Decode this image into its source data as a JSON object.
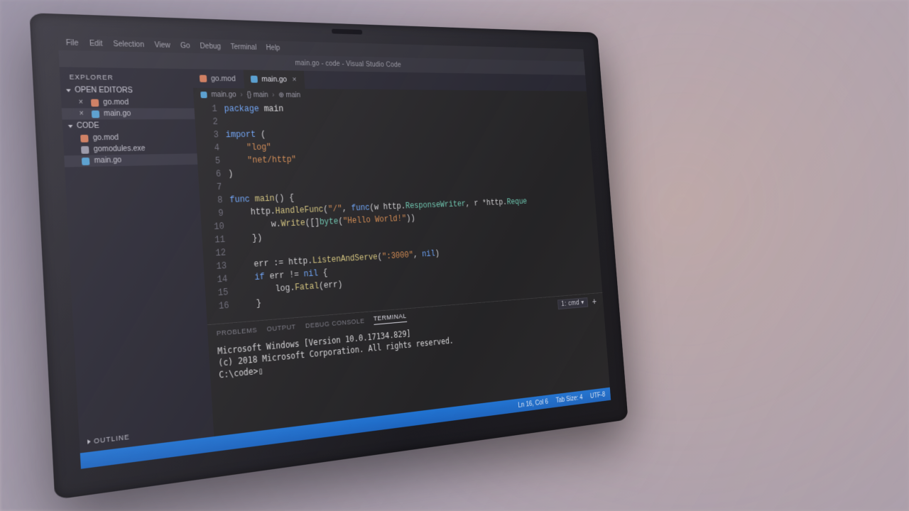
{
  "title": "main.go - code - Visual Studio Code",
  "menu": [
    "File",
    "Edit",
    "Selection",
    "View",
    "Go",
    "Debug",
    "Terminal",
    "Help"
  ],
  "sidebar": {
    "title": "EXPLORER",
    "sections": [
      {
        "label": "OPEN EDITORS",
        "items": [
          {
            "icon": "mod",
            "name": "go.mod",
            "closable": true
          },
          {
            "icon": "go",
            "name": "main.go",
            "closable": true,
            "active": true
          }
        ]
      },
      {
        "label": "CODE",
        "items": [
          {
            "icon": "mod",
            "name": "go.mod"
          },
          {
            "icon": "exe",
            "name": "gomodules.exe"
          },
          {
            "icon": "go",
            "name": "main.go",
            "active": true
          }
        ]
      }
    ],
    "outline": "OUTLINE"
  },
  "tabs": [
    {
      "icon": "mod",
      "label": "go.mod"
    },
    {
      "icon": "go",
      "label": "main.go",
      "active": true,
      "closable": true
    }
  ],
  "breadcrumb": [
    "main.go",
    "{} main",
    "⊕ main"
  ],
  "code": {
    "lines": [
      {
        "n": 1,
        "html": "<span class='kw'>package</span> <span class='pkg'>main</span>"
      },
      {
        "n": 2,
        "html": ""
      },
      {
        "n": 3,
        "html": "<span class='kw'>import</span> ("
      },
      {
        "n": 4,
        "html": "    <span class='str'>\"log\"</span>"
      },
      {
        "n": 5,
        "html": "    <span class='str'>\"net/http\"</span>"
      },
      {
        "n": 6,
        "html": ")"
      },
      {
        "n": 7,
        "html": ""
      },
      {
        "n": 8,
        "html": "<span class='kw'>func</span> <span class='fn'>main</span>() {"
      },
      {
        "n": 9,
        "html": "    http.<span class='fn'>HandleFunc</span>(<span class='str'>\"/\"</span>, <span class='kw'>func</span>(w http.<span class='typ'>ResponseWriter</span>, r *http.<span class='typ'>Reque</span>"
      },
      {
        "n": 10,
        "html": "        w.<span class='fn'>Write</span>([]<span class='typ'>byte</span>(<span class='str'>\"Hello World!\"</span>))"
      },
      {
        "n": 11,
        "html": "    })"
      },
      {
        "n": 12,
        "html": ""
      },
      {
        "n": 13,
        "html": "    err := http.<span class='fn'>ListenAndServe</span>(<span class='str'>\":3000\"</span>, <span class='kw'>nil</span>)"
      },
      {
        "n": 14,
        "html": "    <span class='kw'>if</span> err != <span class='kw'>nil</span> {"
      },
      {
        "n": 15,
        "html": "        log.<span class='fn'>Fatal</span>(err)"
      },
      {
        "n": 16,
        "html": "    }"
      }
    ]
  },
  "panel": {
    "tabs": [
      "PROBLEMS",
      "OUTPUT",
      "DEBUG CONSOLE",
      "TERMINAL"
    ],
    "active": "TERMINAL",
    "shellLabel": "1: cmd",
    "terminal": {
      "line1": "Microsoft Windows [Version 10.0.17134.829]",
      "line2": "(c) 2018 Microsoft Corporation. All rights reserved.",
      "blank": "",
      "prompt": "C:\\code>▯"
    }
  },
  "status": {
    "left": [],
    "right": [
      "Ln 16, Col 6",
      "Tab Size: 4",
      "UTF-8"
    ]
  }
}
